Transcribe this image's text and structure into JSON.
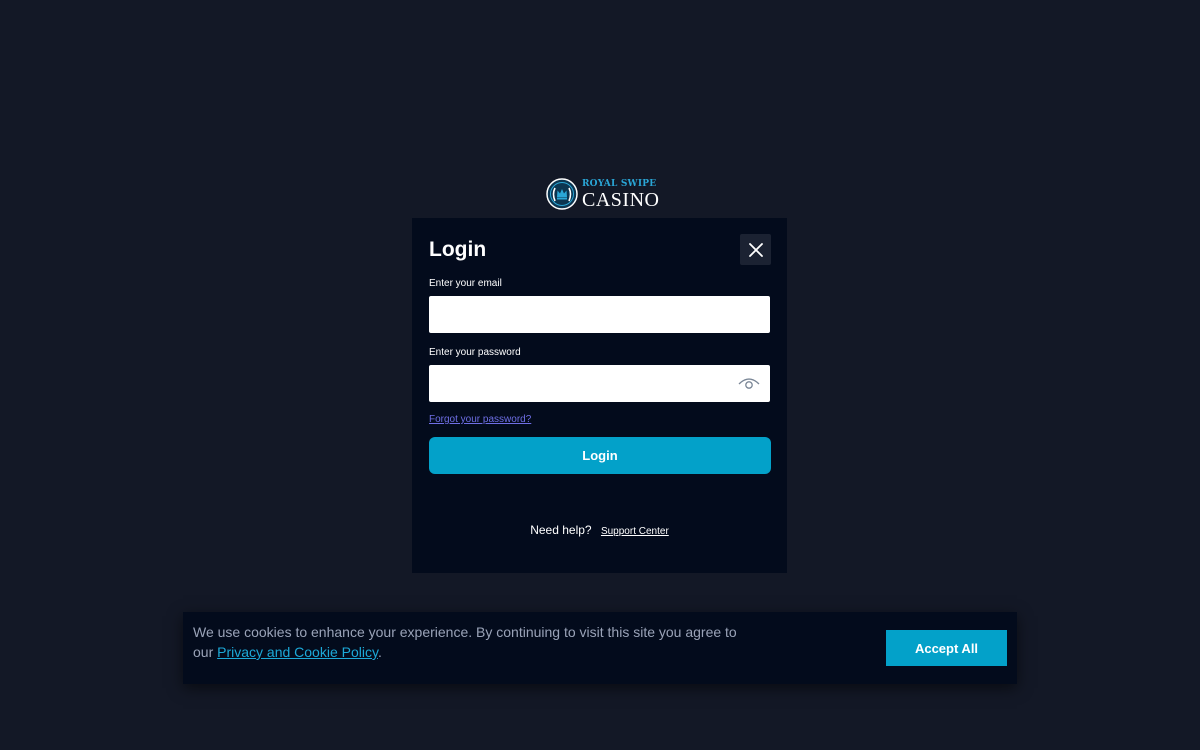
{
  "brand": {
    "logo_top": "ROYAL SWIPE",
    "logo_bottom": "CASINO",
    "accent_color": "#03a1c9"
  },
  "login_modal": {
    "title": "Login",
    "close_icon": "close-icon",
    "email_label": "Enter your email",
    "email_value": "",
    "password_label": "Enter your password",
    "password_value": "",
    "password_toggle_icon": "eye-icon",
    "forgot_link": "Forgot your password?",
    "submit_label": "Login",
    "help_text": "Need help?",
    "support_link": "Support Center"
  },
  "cookie_banner": {
    "text_before": "We use cookies to enhance your experience. By continuing to visit this site you agree to our ",
    "policy_link": "Privacy and Cookie Policy",
    "text_after": ".",
    "accept_label": "Accept All"
  }
}
